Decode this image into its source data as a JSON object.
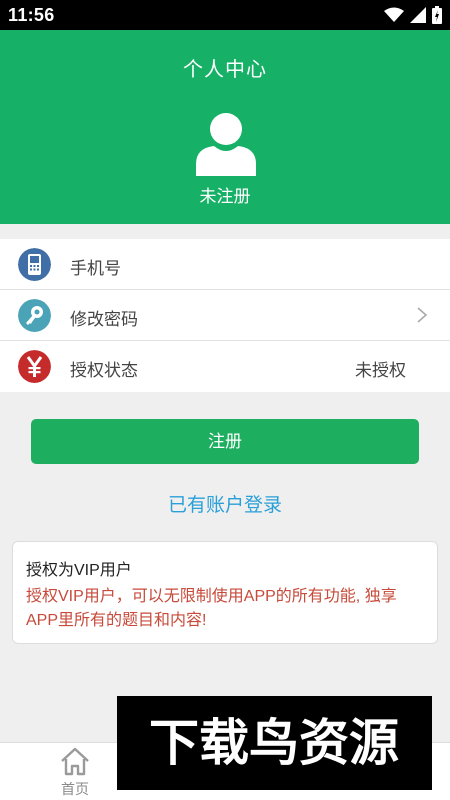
{
  "status_bar": {
    "time": "11:56"
  },
  "header": {
    "title": "个人中心",
    "username": "未注册"
  },
  "menu": [
    {
      "icon": "phone-icon",
      "label": "手机号",
      "value": "",
      "color": "#3f6fa6"
    },
    {
      "icon": "key-icon",
      "label": "修改密码",
      "value": "",
      "color": "#4aa3b6"
    },
    {
      "icon": "yen-icon",
      "label": "授权状态",
      "value": "未授权",
      "color": "#c62b2b"
    }
  ],
  "register_button": "注册",
  "login_link": "已有账户登录",
  "vip_card": {
    "title": "授权为VIP用户",
    "description": "授权VIP用户，可以无限制使用APP的所有功能, 独享APP里所有的题目和内容!"
  },
  "tabs": [
    {
      "label": "首页",
      "icon": "home-icon"
    },
    {
      "label": "",
      "icon": ""
    },
    {
      "label": "",
      "icon": ""
    }
  ],
  "watermark": {
    "text": "下载鸟资源"
  },
  "colors": {
    "header_green": "#17b067",
    "button_green": "#1eae5f",
    "link_blue": "#2aa0d8",
    "vip_red": "#c74a3a"
  }
}
